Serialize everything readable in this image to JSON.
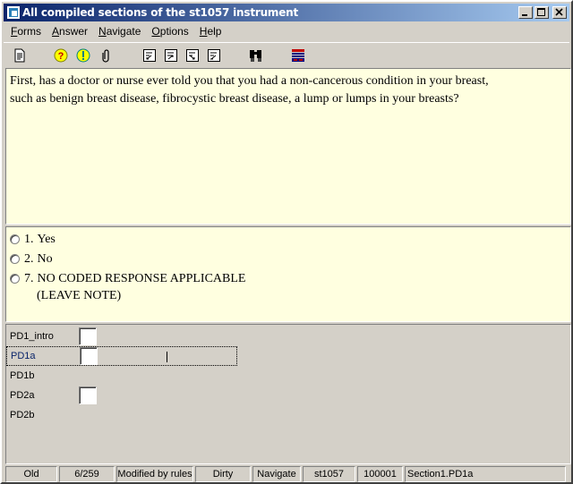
{
  "window": {
    "title": "All compiled sections of the st1057 instrument",
    "controls": [
      "minimize",
      "maximize",
      "close"
    ]
  },
  "menu": {
    "items": [
      {
        "label": "Forms",
        "accel": "F"
      },
      {
        "label": "Answer",
        "accel": "A"
      },
      {
        "label": "Navigate",
        "accel": "N"
      },
      {
        "label": "Options",
        "accel": "O"
      },
      {
        "label": "Help",
        "accel": "H"
      }
    ]
  },
  "toolbar": {
    "icons": [
      "document-icon",
      "help-question-icon",
      "exclamation-icon",
      "paperclip-icon",
      "nav-first-icon",
      "nav-prev-icon",
      "nav-next-icon",
      "nav-last-icon",
      "find-binoculars-icon",
      "layout-icon"
    ]
  },
  "question": {
    "line1": "First, has a doctor or nurse ever told you that you had a non-cancerous condition in your breast,",
    "line2": "such as benign breast disease, fibrocystic breast disease, a lump or lumps in your breasts?"
  },
  "answers": {
    "options": [
      {
        "num": "1.",
        "label": "Yes"
      },
      {
        "num": "2.",
        "label": "No"
      },
      {
        "num": "7.",
        "label": "NO CODED RESPONSE APPLICABLE",
        "continuation": "(LEAVE NOTE)"
      }
    ]
  },
  "form": {
    "fields": [
      {
        "name": "PD1_intro",
        "has_box": true,
        "active": false
      },
      {
        "name": "PD1a",
        "has_box": true,
        "active": true
      },
      {
        "name": "PD1b",
        "has_box": false,
        "active": false
      },
      {
        "name": "PD2a",
        "has_box": true,
        "active": false
      },
      {
        "name": "PD2b",
        "has_box": false,
        "active": false
      }
    ]
  },
  "status": {
    "cells": [
      {
        "text": "Old"
      },
      {
        "text": "6/259"
      },
      {
        "text": "Modified by rules"
      },
      {
        "text": "Dirty"
      },
      {
        "text": "Navigate"
      },
      {
        "text": "st1057"
      },
      {
        "text": "100001"
      },
      {
        "text": "Section1.PD1a"
      }
    ]
  },
  "colors": {
    "title_bar": "#0a246a",
    "pane_background": "#ffffe0",
    "chrome": "#d4d0c8"
  }
}
